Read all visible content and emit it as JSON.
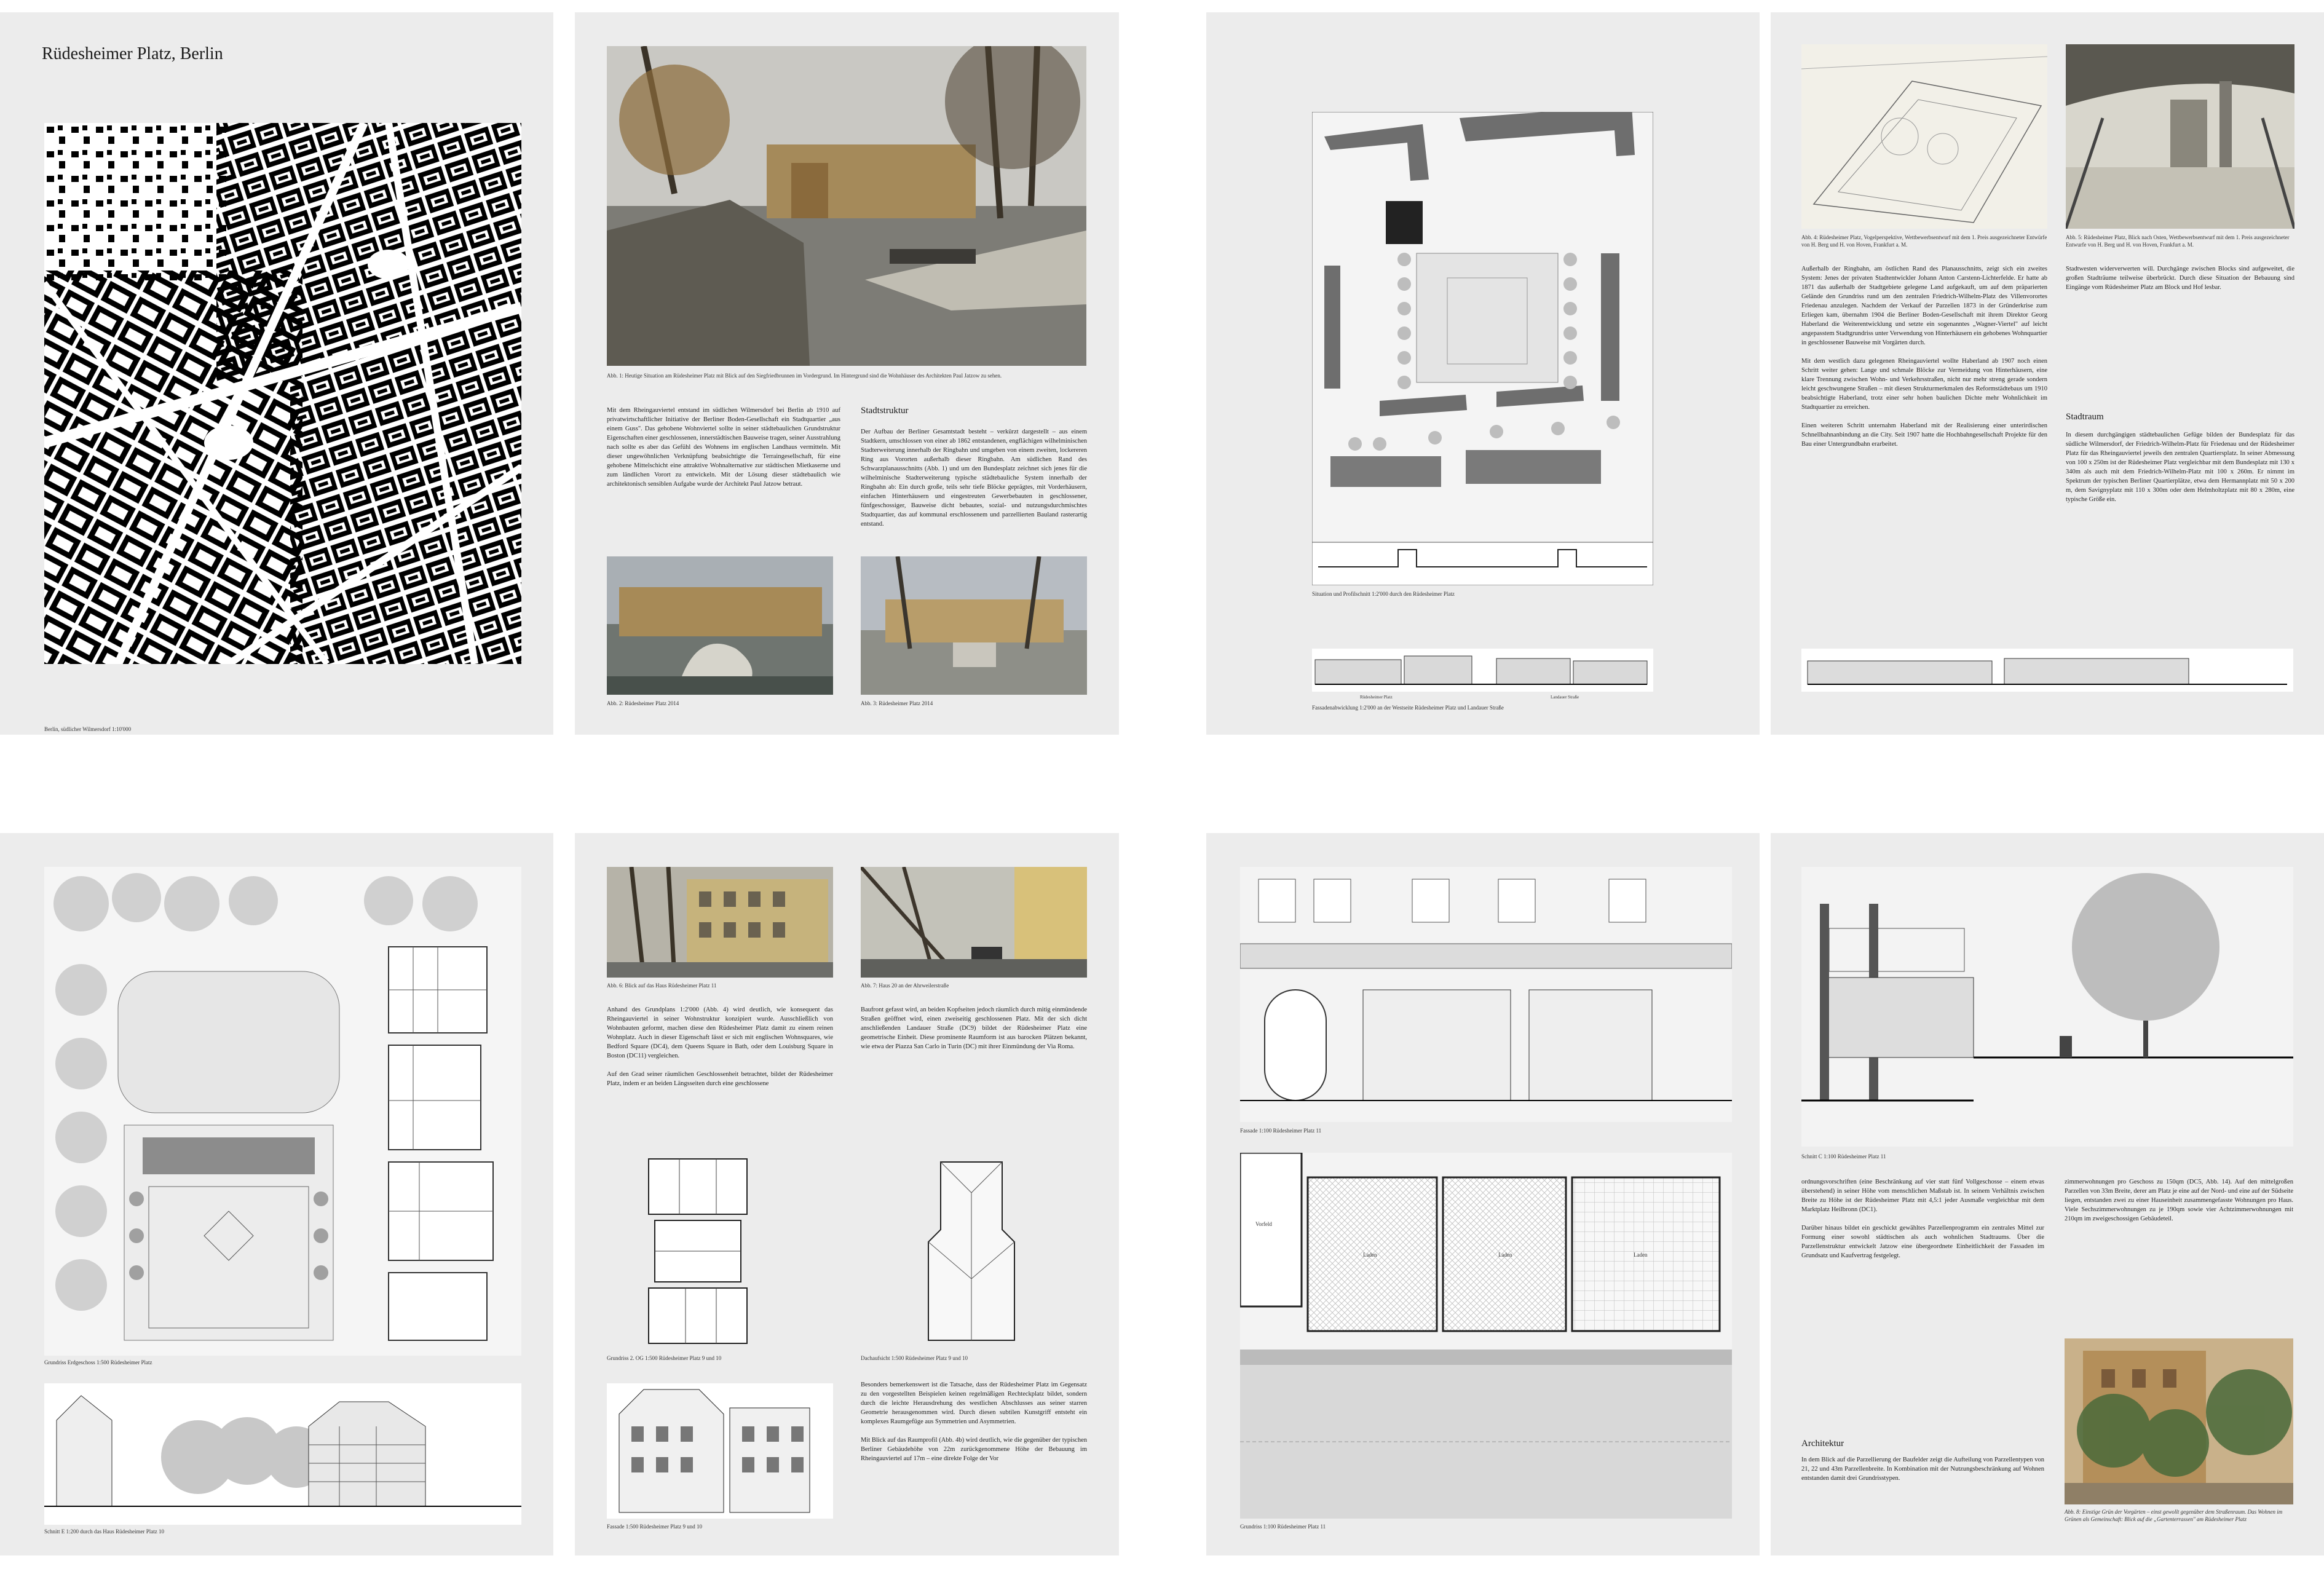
{
  "spreads": [
    {
      "left_page": {
        "title": "Rüdesheimer Platz, Berlin",
        "map_caption": "Berlin, südlicher Wilmersdorf 1:10'000"
      },
      "right_page": {
        "fig1_caption": "Abb. 1: Heutige Situation am Rüdesheimer Platz mit Blick auf den Siegfriedbrunnen im Vordergrund. Im Hintergrund sind die Wohnhäuser des Architekten Paul Jatzow zu sehen.",
        "intro_text": "Mit dem Rheingauviertel entstand im südlichen Wilmersdorf bei Berlin ab 1910 auf privatwirtschaftlicher Initiative der Berliner Boden-Gesellschaft ein Stadtquartier „aus einem Guss\". Das gehobene Wohnviertel sollte in seiner städtebaulichen Grundstruktur Eigenschaften einer geschlossenen, innerstädtischen Bauweise tragen, seiner Ausstrahlung nach sollte es aber das Gefühl des Wohnens im englischen Landhaus vermitteln. Mit dieser ungewöhnlichen Verknüpfung beabsichtigte die Terraingesellschaft, für eine gehobene Mittelschicht eine attraktive Wohnalternative zur städtischen Mietkaserne und zum ländlichen Vorort zu entwickeln. Mit der Lösung dieser städtebaulich wie architektonisch sensiblen Aufgabe wurde der Architekt Paul Jatzow betraut.",
        "section_heading": "Stadtstruktur",
        "section_text": "Der Aufbau der Berliner Gesamtstadt besteht – verkürzt dargestellt – aus einem Stadtkern, umschlossen von einer ab 1862 entstandenen, engflächigen wilhelminischen Stadterweiterung innerhalb der Ringbahn und umgeben von einem zweiten, lockereren Ring aus Vororten außerhalb dieser Ringbahn. Am südlichen Rand des Schwarzplanausschnitts (Abb. 1) und um den Bundesplatz zeichnet sich jenes für die wilhelminische Stadterweiterung typische städtebauliche System innerhalb der Ringbahn ab: Ein durch große, teils sehr tiefe Blöcke geprägtes, mit Vorderhäusern, einfachen Hinterhäusern und eingestreuten Gewerbebauten in geschlossener, fünfgeschossiger, Bauweise dicht bebautes, sozial- und nutzungsdurchmischtes Stadtquartier, das auf kommunal erschlossenem und parzellierten Bauland rasterartig entstand.",
        "fig2_caption": "Abb. 2: Rüdesheimer Platz 2014",
        "fig3_caption": "Abb. 3: Rüdesheimer Platz 2014"
      }
    },
    {
      "left_page": {
        "plan_caption": "Situation und Profilschnitt 1:2'000 durch den Rüdesheimer Platz",
        "facade_caption": "Fassadenabwicklung 1:2'000 an der Westseite Rüdesheimer Platz und Landauer Straße",
        "facade_labels": [
          "Rüdesheimer Platz",
          "Landauer Straße"
        ]
      },
      "right_page": {
        "fig4_caption": "Abb. 4: Rüdesheimer Platz, Vogelperspektive, Wettbewerbsentwurf mit dem 1. Preis ausgezeichneter Entwürfe von H. Berg und H. von Hoven, Frankfurt a. M.",
        "fig5_caption": "Abb. 5: Rüdesheimer Platz, Blick nach Osten, Wettbewerbsentwurf mit dem 1. Preis ausgezeichneter Entwurfe von H. Berg und H. von Hoven, Frankfurt a. M.",
        "text_col1": "Außerhalb der Ringbahn, am östlichen Rand des Planausschnitts, zeigt sich ein zweites System: Jenes der privaten Stadtentwickler Johann Anton Carstenn-Lichterfelde. Er hatte ab 1871 das außerhalb der Stadtgebiete gelegene Land aufgekauft, um auf dem präparierten Gelände den Grundriss rund um den zentralen Friedrich-Wilhelm-Platz des Villenvorortes Friedenau anzulegen. Nachdem der Verkauf der Parzellen 1873 in der Gründerkrise zum Erliegen kam, übernahm 1904 die Berliner Boden-Gesellschaft mit ihrem Direktor Georg Haberland die Weiterentwicklung und setzte ein sogenanntes „Wagner-Viertel\" auf leicht angepasstem Stadtgrundriss unter Verwendung von Hinterhäusern ein gehobenes Wohnquartier in geschlossener Bauweise mit Vorgärten durch.\n\nMit dem westlich dazu gelegenen Rheingauviertel wollte Haberland ab 1907 noch einen Schritt weiter gehen: Lange und schmale Blöcke zur Vermeidung von Hinterhäusern, eine klare Trennung zwischen Wohn- und Verkehrsstraßen, nicht nur mehr streng gerade sondern leicht geschwungene Straßen – mit diesen Strukturmerkmalen des Reformstädtebaus um 1910 beabsichtigte Haberland, trotz einer sehr hohen baulichen Dichte mehr Wohnlichkeit im Stadtquartier zu erreichen.\n\nEinen weiteren Schritt unternahm Haberland mit der Realisierung einer unterirdischen Schnellbahnanbindung an die City. Seit 1907 hatte die Hochbahngesellschaft Projekte für den Bau einer Untergrundbahn erarbeitet.",
        "text_col2": "Stadtwesten widerverwerten will. Durchgänge zwischen Blocks sind aufgeweitet, die großen Stadträume teilweise überbrückt. Durch diese Situation der Bebauung sind Eingänge vom Rüdesheimer Platz am Block und Hof lesbar.",
        "col2_heading": "Stadtraum",
        "col2_text": "In diesem durchgängigen städtebaulichen Gefüge bilden der Bundesplatz für das südliche Wilmersdorf, der Friedrich-Wilhelm-Platz für Friedenau und der Rüdesheimer Platz für das Rheingauviertel jeweils den zentralen Quartiersplatz. In seiner Abmessung von 100 x 250m ist der Rüdesheimer Platz vergleichbar mit dem Bundesplatz mit 130 x 340m als auch mit dem Friedrich-Wilhelm-Platz mit 100 x 260m. Er nimmt im Spektrum der typischen Berliner Quartierplätze, etwa dem Hermannplatz mit 50 x 200 m, dem Savignyplatz mit 110 x 300m oder dem Helmholtzplatz mit 80 x 280m, eine typische Größe ein."
      }
    },
    {
      "left_page": {
        "plan_caption": "Grundriss Erdgeschoss 1:500 Rüdesheimer Platz",
        "section_caption": "Schnitt E 1:200 durch das Haus Rüdesheimer Platz 10"
      },
      "right_page": {
        "fig6_caption": "Abb. 6: Blick auf das Haus Rüdesheimer Platz 11",
        "fig7_caption": "Abb. 7: Haus 20 an der Ahrweilerstraße",
        "text_col1": "Anhand des Grundplans 1:2'000 (Abb. 4) wird deutlich, wie konsequent das Rheingauviertel in seiner Wohnstruktur konzipiert wurde. Ausschließlich von Wohnbauten geformt, machen diese den Rüdesheimer Platz damit zu einem reinen Wohnplatz. Auch in dieser Eigenschaft lässt er sich mit englischen Wohnsquares, wie Bedford Square (DC4), dem Queens Square in Bath, oder dem Louisburg Square in Boston (DC11) vergleichen.\n\nAuf den Grad seiner räumlichen Geschlossenheit betrachtet, bildet der Rüdesheimer Platz, indem er an beiden Längsseiten durch eine geschlossene",
        "text_col2": "Baufront gefasst wird, an beiden Kopfseiten jedoch räumlich durch mitig einmündende Straßen geöffnet wird, einen zweiseitig geschlossenen Platz. Mit der sich dicht anschließenden Landauer Straße (DC9) bildet der Rüdesheimer Platz eine geometrische Einheit. Diese prominente Raumform ist aus barocken Plätzen bekannt, wie etwa der Piazza San Carlo in Turin (DC) mit ihrer Einmündung der Via Roma.",
        "plan2_caption": "Grundriss 2. OG 1:500 Rüdesheimer Platz 9 und 10",
        "roof_caption": "Dachaufsicht 1:500 Rüdesheimer Platz 9 und 10",
        "facade_caption": "Fassade 1:500 Rüdesheimer Platz 9 und 10",
        "text_col3": "Besonders bemerkenswert ist die Tatsache, dass der Rüdesheimer Platz im Gegensatz zu den vorgestellten Beispielen keinen regelmäßigen Rechteckplatz bildet, sondern durch die leichte Herausdrehung des westlichen Abschlusses aus seiner starren Geometrie herausgenommen wird. Durch diesen subtilen Kunstgriff entsteht ein komplexes Raumgefüge aus Symmetrien und Asymmetrien.\n\nMit Blick auf das Raumprofil (Abb. 4b) wird deutlich, wie die gegenüber der typischen Berliner Gebäudehöhe von 22m zurückgenommene Höhe der Bebauung im Rheingauviertel auf 17m – eine direkte Folge der Vor"
      }
    },
    {
      "left_page": {
        "facade_caption": "Fassade 1:100 Rüdesheimer Platz 11",
        "plan_caption": "Grundriss 1:100 Rüdesheimer Platz 11",
        "room_labels": [
          "Vorfeld",
          "Laden",
          "Laden",
          "Laden"
        ]
      },
      "right_page": {
        "section_caption": "Schnitt C 1:100 Rüdesheimer Platz 11",
        "text_col1": "ordnungsvorschriften (eine Beschränkung auf vier statt fünf Vollgeschosse – einem etwas überstehend) in seiner Höhe vom menschlichen Maßstab ist. In seinem Verhältnis zwischen Breite zu Höhe ist der Rüdesheimer Platz mit 4,5:1 jeder Ausmaße vergleichbar mit dem Marktplatz Heilbronn (DC1).\n\nDarüber hinaus bildet ein geschickt gewähltes Parzellenprogramm ein zentrales Mittel zur Formung einer sowohl städtischen als auch wohnlichen Stadtraums. Über die Parzellenstruktur entwickelt Jatzow eine übergeordnete Einheitlichkeit der Fassaden im Grundsatz und Kaufvertrag festgelegt.",
        "heading": "Architektur",
        "text_col1b": "In dem Blick auf die Parzellierung der Baufelder zeigt die Aufteilung von Parzellentypen von 21, 22 und 43m Parzellenbreite. In Kombination mit der Nutzungsbeschränkung auf Wohnen entstanden damit drei Grundrisstypen.",
        "text_col2": "zimmerwohnungen pro Geschoss zu 150qm (DC5, Abb. 14). Auf den mittelgroßen Parzellen von 33m Breite, derer am Platz je eine auf der Nord- und eine auf der Südseite liegen, entstanden zwei zu einer Hauseinheit zusammengefasste Wohnungen pro Haus. Viele Sechszimmerwohnungen zu je 190qm sowie vier Achtzimmerwohnungen mit 210qm im zweigeschossigen Gebäudeteil.",
        "fig8_caption": "Abb. 8: Einstige Grün der Vorgärten – einst gewollt gegenüber dem Straßenraum. Das Wohnen im Grünen als Gemeinschaft: Blick auf die „Gartenterrassen\" am Rüdesheimer Platz"
      }
    }
  ]
}
